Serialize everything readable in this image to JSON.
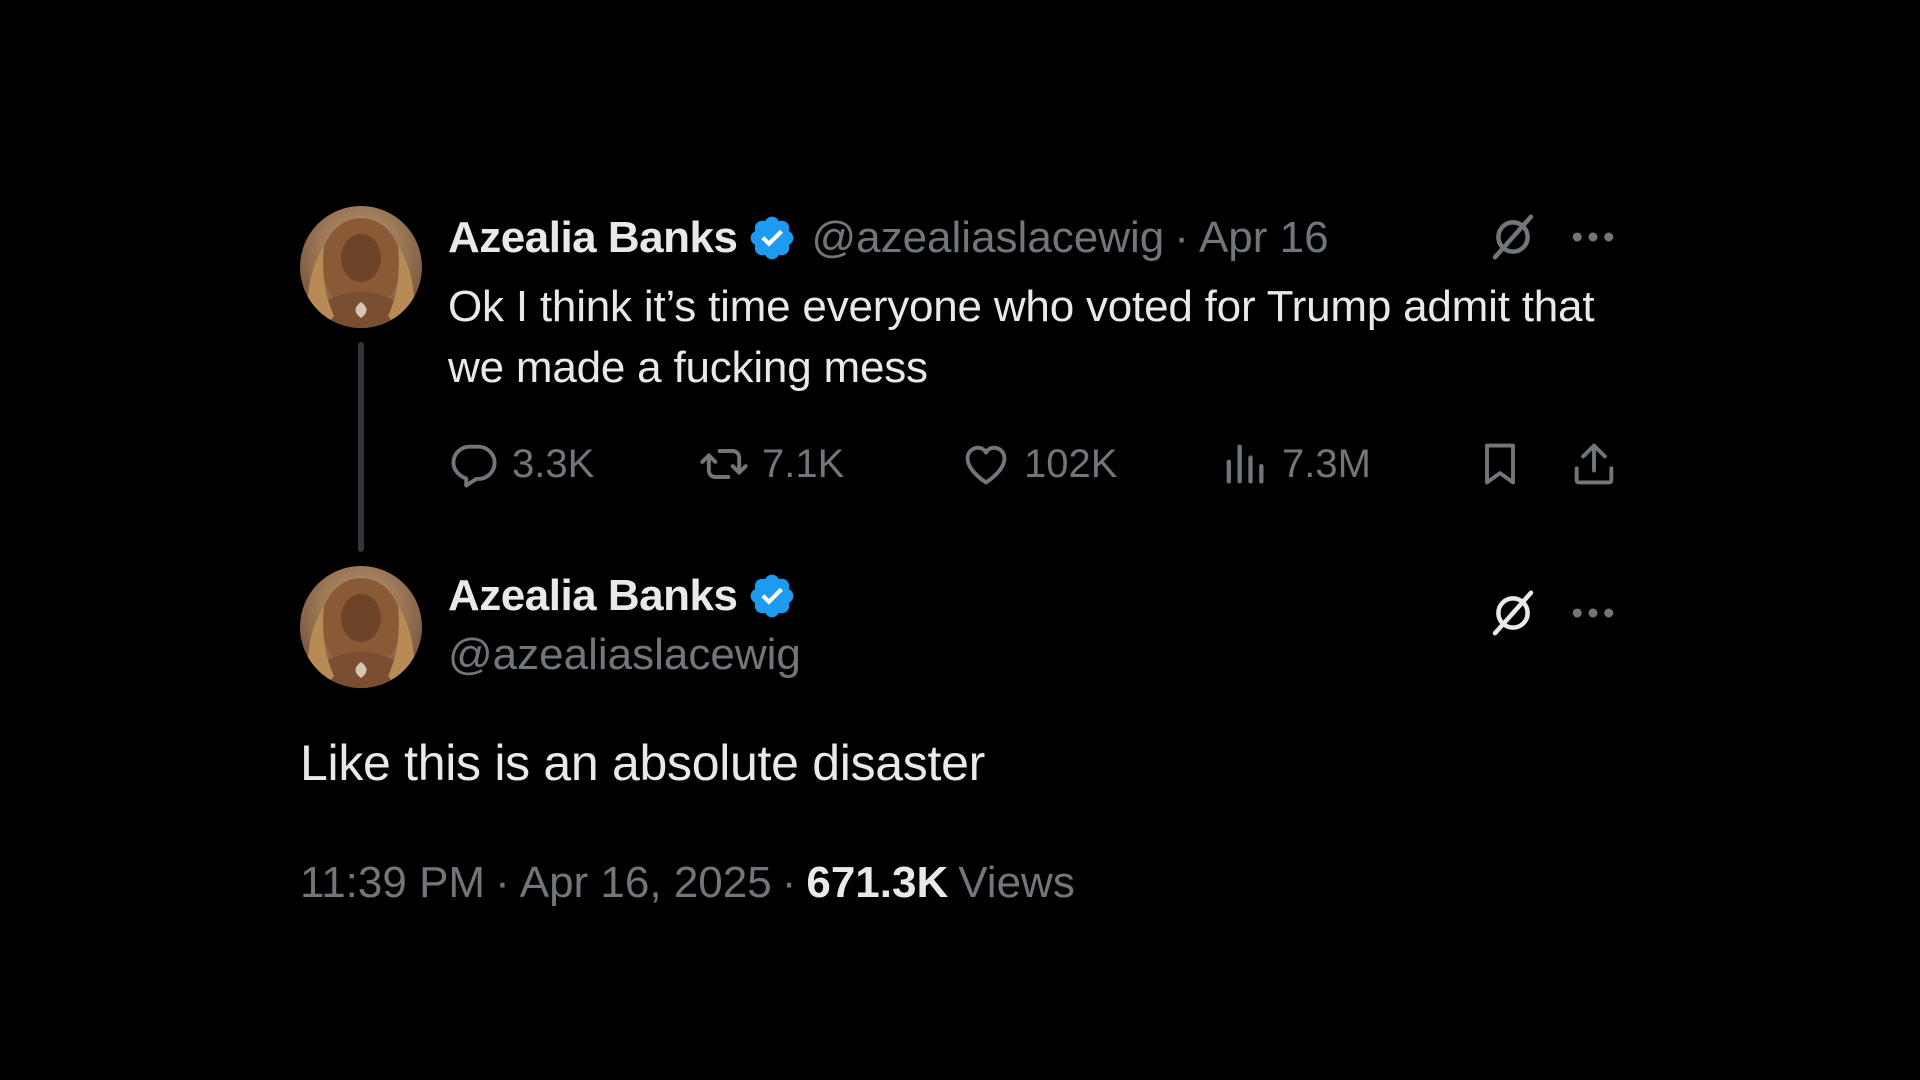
{
  "colors": {
    "background": "#000000",
    "text_primary": "#e7e9ea",
    "text_secondary": "#71767b",
    "verified_blue": "#1d9bf0",
    "thread_line": "#333639"
  },
  "parent_tweet": {
    "display_name": "Azealia Banks",
    "handle": "@azealiaslacewig",
    "separator": "·",
    "date": "Apr 16",
    "verified_icon": "verified-badge-icon",
    "text": "Ok I think it’s time everyone who voted for Trump admit that we made a fucking mess",
    "actions": {
      "replies": "3.3K",
      "retweets": "7.1K",
      "likes": "102K",
      "views": "7.3M"
    },
    "icons": [
      "reply-icon",
      "retweet-icon",
      "like-icon",
      "views-icon",
      "bookmark-icon",
      "share-icon",
      "grok-icon",
      "more-icon"
    ]
  },
  "main_tweet": {
    "display_name": "Azealia Banks",
    "handle": "@azealiaslacewig",
    "verified_icon": "verified-badge-icon",
    "text": "Like this is an absolute disaster",
    "time": "11:39 PM",
    "separator": "·",
    "date": "Apr 16, 2025",
    "views_count": "671.3K",
    "views_label": "Views",
    "icons": [
      "grok-icon",
      "more-icon"
    ]
  }
}
